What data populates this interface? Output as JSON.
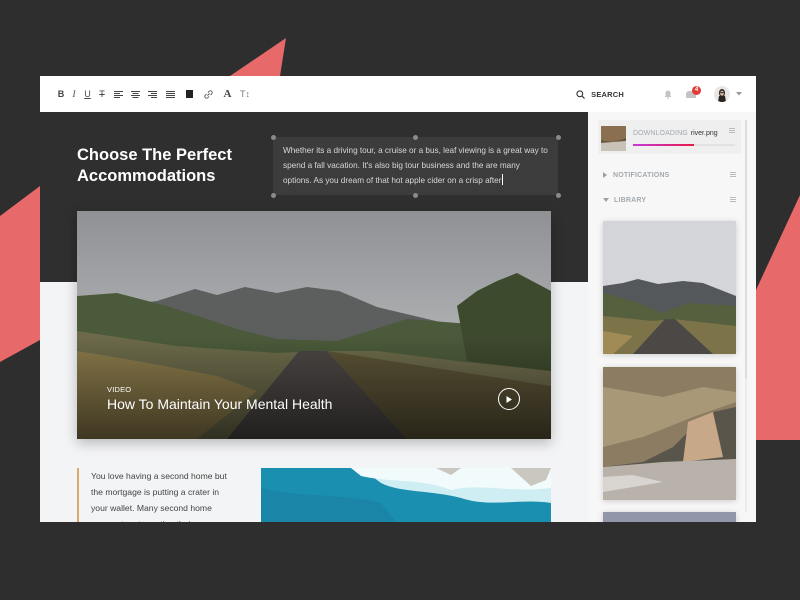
{
  "colors": {
    "background": "#2e2e2e",
    "accent_shape": "#e8696a",
    "download_progress_start": "#c43ad8",
    "download_progress_end": "#e5194a",
    "notification_badge": "#e53935",
    "quote_border": "#d9a86a"
  },
  "toolbar": {
    "format_buttons": [
      {
        "name": "bold",
        "label": "B"
      },
      {
        "name": "italic",
        "label": "I"
      },
      {
        "name": "underline",
        "label": "U"
      },
      {
        "name": "strikethrough",
        "label": "T"
      },
      {
        "name": "align-left",
        "label": ""
      },
      {
        "name": "align-center",
        "label": ""
      },
      {
        "name": "align-right",
        "label": ""
      },
      {
        "name": "align-justify",
        "label": ""
      },
      {
        "name": "text-color",
        "label": ""
      },
      {
        "name": "link",
        "label": ""
      },
      {
        "name": "font",
        "label": "A"
      },
      {
        "name": "text-size",
        "label": "T↕"
      }
    ],
    "search_label": "SEARCH",
    "notifications_icon": "bell-icon",
    "inbox_icon": "inbox-icon",
    "inbox_badge_count": "4",
    "avatar_icon": "user-avatar",
    "avatar_menu_icon": "caret-down-icon"
  },
  "editor": {
    "headline": "Choose The Perfect Accommodations",
    "selected_text": "Whether its a driving tour, a cruise or a bus, leaf viewing is a great way to spend a fall vacation. It's also big tour business and the are many options. As you dream of that hot apple cider on a crisp after",
    "hero": {
      "kicker": "VIDEO",
      "title": "How To Maintain Your Mental Health",
      "play_icon": "play-icon"
    },
    "quote": "You love having a second home but the mortgage is putting a crater in your wallet. Many second home owners turn to renting their property as a vacation rental to help"
  },
  "sidebar": {
    "download": {
      "status": "DOWNLOADING",
      "filename": "river.png",
      "progress_percent": 60
    },
    "sections": [
      {
        "label": "NOTIFICATIONS",
        "expanded": false
      },
      {
        "label": "LIBRARY",
        "expanded": true
      }
    ],
    "library_images": [
      {
        "subject": "mountain road"
      },
      {
        "subject": "sea cave"
      },
      {
        "subject": "sky"
      }
    ]
  }
}
